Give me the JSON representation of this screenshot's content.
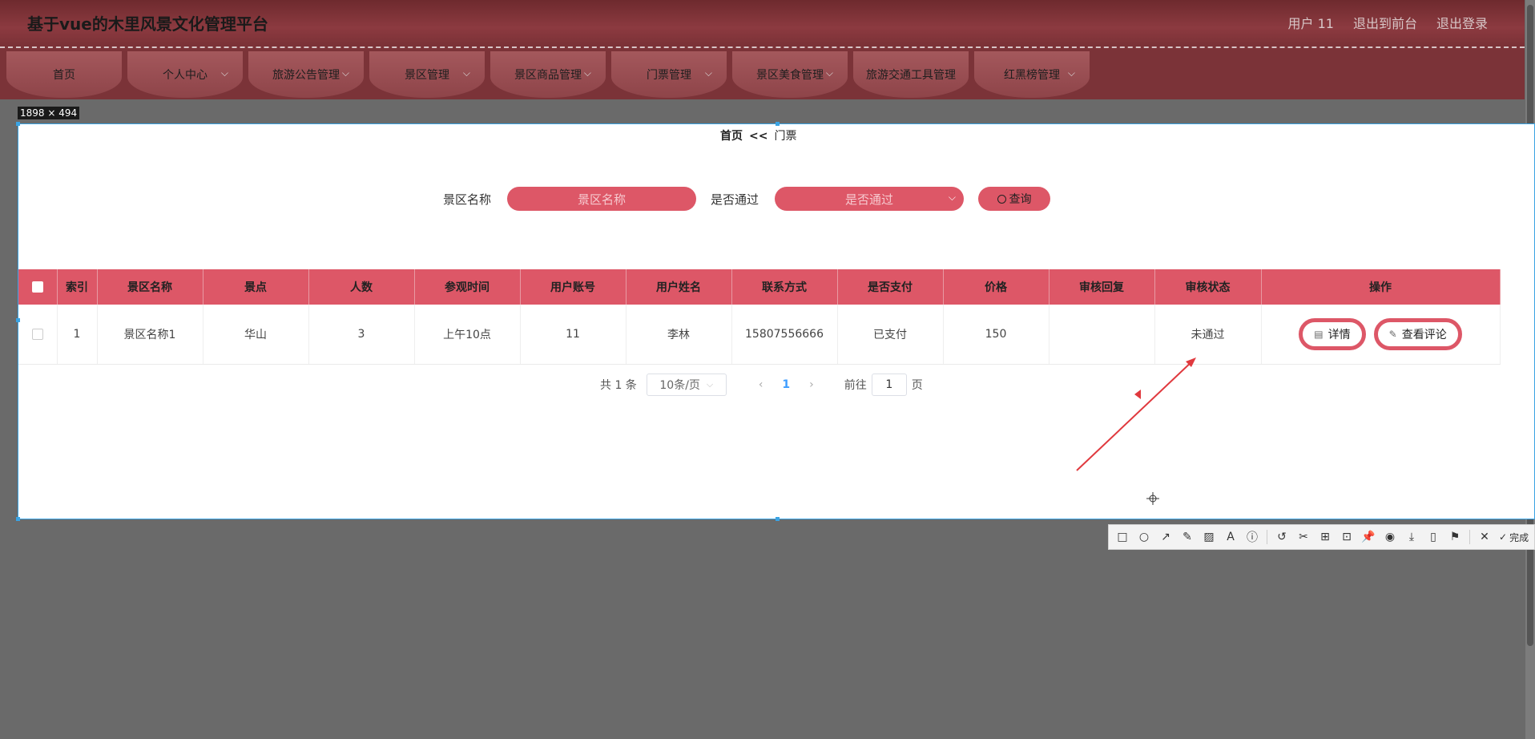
{
  "header": {
    "title": "基于vue的木里风景文化管理平台",
    "user": "用户 11",
    "to_front": "退出到前台",
    "logout": "退出登录"
  },
  "nav": [
    {
      "label": "首页"
    },
    {
      "label": "个人中心"
    },
    {
      "label": "旅游公告管理"
    },
    {
      "label": "景区管理"
    },
    {
      "label": "景区商品管理"
    },
    {
      "label": "门票管理"
    },
    {
      "label": "景区美食管理"
    },
    {
      "label": "旅游交通工具管理"
    },
    {
      "label": "红黑榜管理"
    }
  ],
  "capture": {
    "size_label": "1898 × 494"
  },
  "breadcrumb": {
    "home": "首页",
    "sep": "<<",
    "current": "门票"
  },
  "search": {
    "scenic_label": "景区名称",
    "scenic_placeholder": "景区名称",
    "approved_label": "是否通过",
    "approved_placeholder": "是否通过",
    "query_label": "查询"
  },
  "table": {
    "headers": [
      "索引",
      "景区名称",
      "景点",
      "人数",
      "参观时间",
      "用户账号",
      "用户姓名",
      "联系方式",
      "是否支付",
      "价格",
      "审核回复",
      "审核状态",
      "操作"
    ],
    "rows": [
      {
        "index": "1",
        "scenic": "景区名称1",
        "spot": "华山",
        "count": "3",
        "time": "上午10点",
        "account": "11",
        "name": "李林",
        "phone": "15807556666",
        "paid": "已支付",
        "price": "150",
        "reply": "",
        "status": "未通过"
      }
    ],
    "actions": {
      "detail": "详情",
      "comments": "查看评论"
    }
  },
  "pager": {
    "total": "共 1 条",
    "page_size": "10条/页",
    "current": "1",
    "goto_label": "前往",
    "goto_value": "1",
    "page_unit": "页"
  },
  "toolbar": {
    "done": "完成"
  },
  "colors": {
    "accent": "#dd5767",
    "header": "#7b3338",
    "selection": "#3aa3e3",
    "arrow": "#e0393e"
  }
}
